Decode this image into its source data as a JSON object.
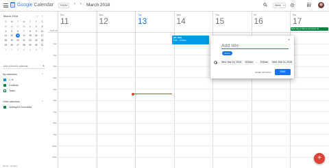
{
  "topbar": {
    "app_name_brand": "Google",
    "app_name_rest": " Calendar",
    "logo_digit": "31",
    "today_label": "TODAY",
    "prev_icon": "‹",
    "next_icon": "›",
    "month_label": "March 2018",
    "view_label": "Week",
    "view_caret": "▾"
  },
  "sidebar": {
    "mini_month": "March 2018",
    "mini_prev": "‹",
    "mini_next": "›",
    "weekday_headers": [
      "S",
      "M",
      "T",
      "W",
      "T",
      "F",
      "S"
    ],
    "days": [
      {
        "d": "25",
        "muted": true
      },
      {
        "d": "26",
        "muted": true
      },
      {
        "d": "27",
        "muted": true
      },
      {
        "d": "28",
        "muted": true
      },
      {
        "d": "1"
      },
      {
        "d": "2"
      },
      {
        "d": "3"
      },
      {
        "d": "4"
      },
      {
        "d": "5"
      },
      {
        "d": "6"
      },
      {
        "d": "7"
      },
      {
        "d": "8"
      },
      {
        "d": "9"
      },
      {
        "d": "10"
      },
      {
        "d": "11"
      },
      {
        "d": "12"
      },
      {
        "d": "13",
        "selected": true
      },
      {
        "d": "14"
      },
      {
        "d": "15"
      },
      {
        "d": "16"
      },
      {
        "d": "17"
      },
      {
        "d": "18"
      },
      {
        "d": "19"
      },
      {
        "d": "20"
      },
      {
        "d": "21"
      },
      {
        "d": "22"
      },
      {
        "d": "23"
      },
      {
        "d": "24"
      },
      {
        "d": "25"
      },
      {
        "d": "26"
      },
      {
        "d": "27"
      },
      {
        "d": "28"
      },
      {
        "d": "29"
      },
      {
        "d": "30"
      },
      {
        "d": "31"
      },
      {
        "d": "1",
        "muted": true
      },
      {
        "d": "2",
        "muted": true
      },
      {
        "d": "3",
        "muted": true
      },
      {
        "d": "4",
        "muted": true
      },
      {
        "d": "5",
        "muted": true
      },
      {
        "d": "6",
        "muted": true
      },
      {
        "d": "7",
        "muted": true
      }
    ],
    "add_friend_label": "Add a friend's calendar",
    "add_friend_icon": "+",
    "my_calendars_label": "My calendars",
    "other_calendars_label": "Other calendars",
    "section_caret": "^",
    "my_calendars": [
      {
        "name": "L. H.",
        "style": "filled blue"
      },
      {
        "name": "Contacts",
        "style": "filled"
      },
      {
        "name": "Tasks",
        "style": "outline"
      }
    ],
    "other_calendars": [
      {
        "name": "Holidays in Indonesia",
        "style": "filled"
      }
    ],
    "terms": "Terms – Privacy"
  },
  "calendar": {
    "timezone": "GMT+07",
    "days": [
      {
        "name": "Sun",
        "num": "11",
        "today": false
      },
      {
        "name": "Mon",
        "num": "12",
        "today": false
      },
      {
        "name": "Tue",
        "num": "13",
        "today": true
      },
      {
        "name": "Wed",
        "num": "14",
        "today": false
      },
      {
        "name": "Thu",
        "num": "15",
        "today": false
      },
      {
        "name": "Fri",
        "num": "16",
        "today": false
      },
      {
        "name": "Sat",
        "num": "17",
        "today": false
      }
    ],
    "hours": [
      "1am",
      "2am",
      "3am",
      "4am",
      "5am",
      "6am",
      "7am",
      "8am",
      "9am",
      "10am",
      "11am",
      "12pm"
    ],
    "allday_event": "Bali's Day of Silence and Hindu Ne",
    "event": {
      "title": "(No title)",
      "time": "8:30 – 9:30am"
    }
  },
  "dialog": {
    "title_placeholder": "Add title",
    "chip_label": "Event",
    "start_date": "Wed, Mar 14, 2018",
    "start_time": "8:30am",
    "dash": "–",
    "end_time": "9:30am",
    "end_date": "Wed, Mar 14, 2018",
    "more_options": "MORE OPTIONS",
    "save_label": "SAVE",
    "close_icon": "×"
  },
  "fab_icon": "+",
  "colors": {
    "accent": "#1a73e8",
    "event": "#039be5",
    "holiday": "#0b8043",
    "now_line": "#ea4335",
    "fab": "#db4437"
  }
}
